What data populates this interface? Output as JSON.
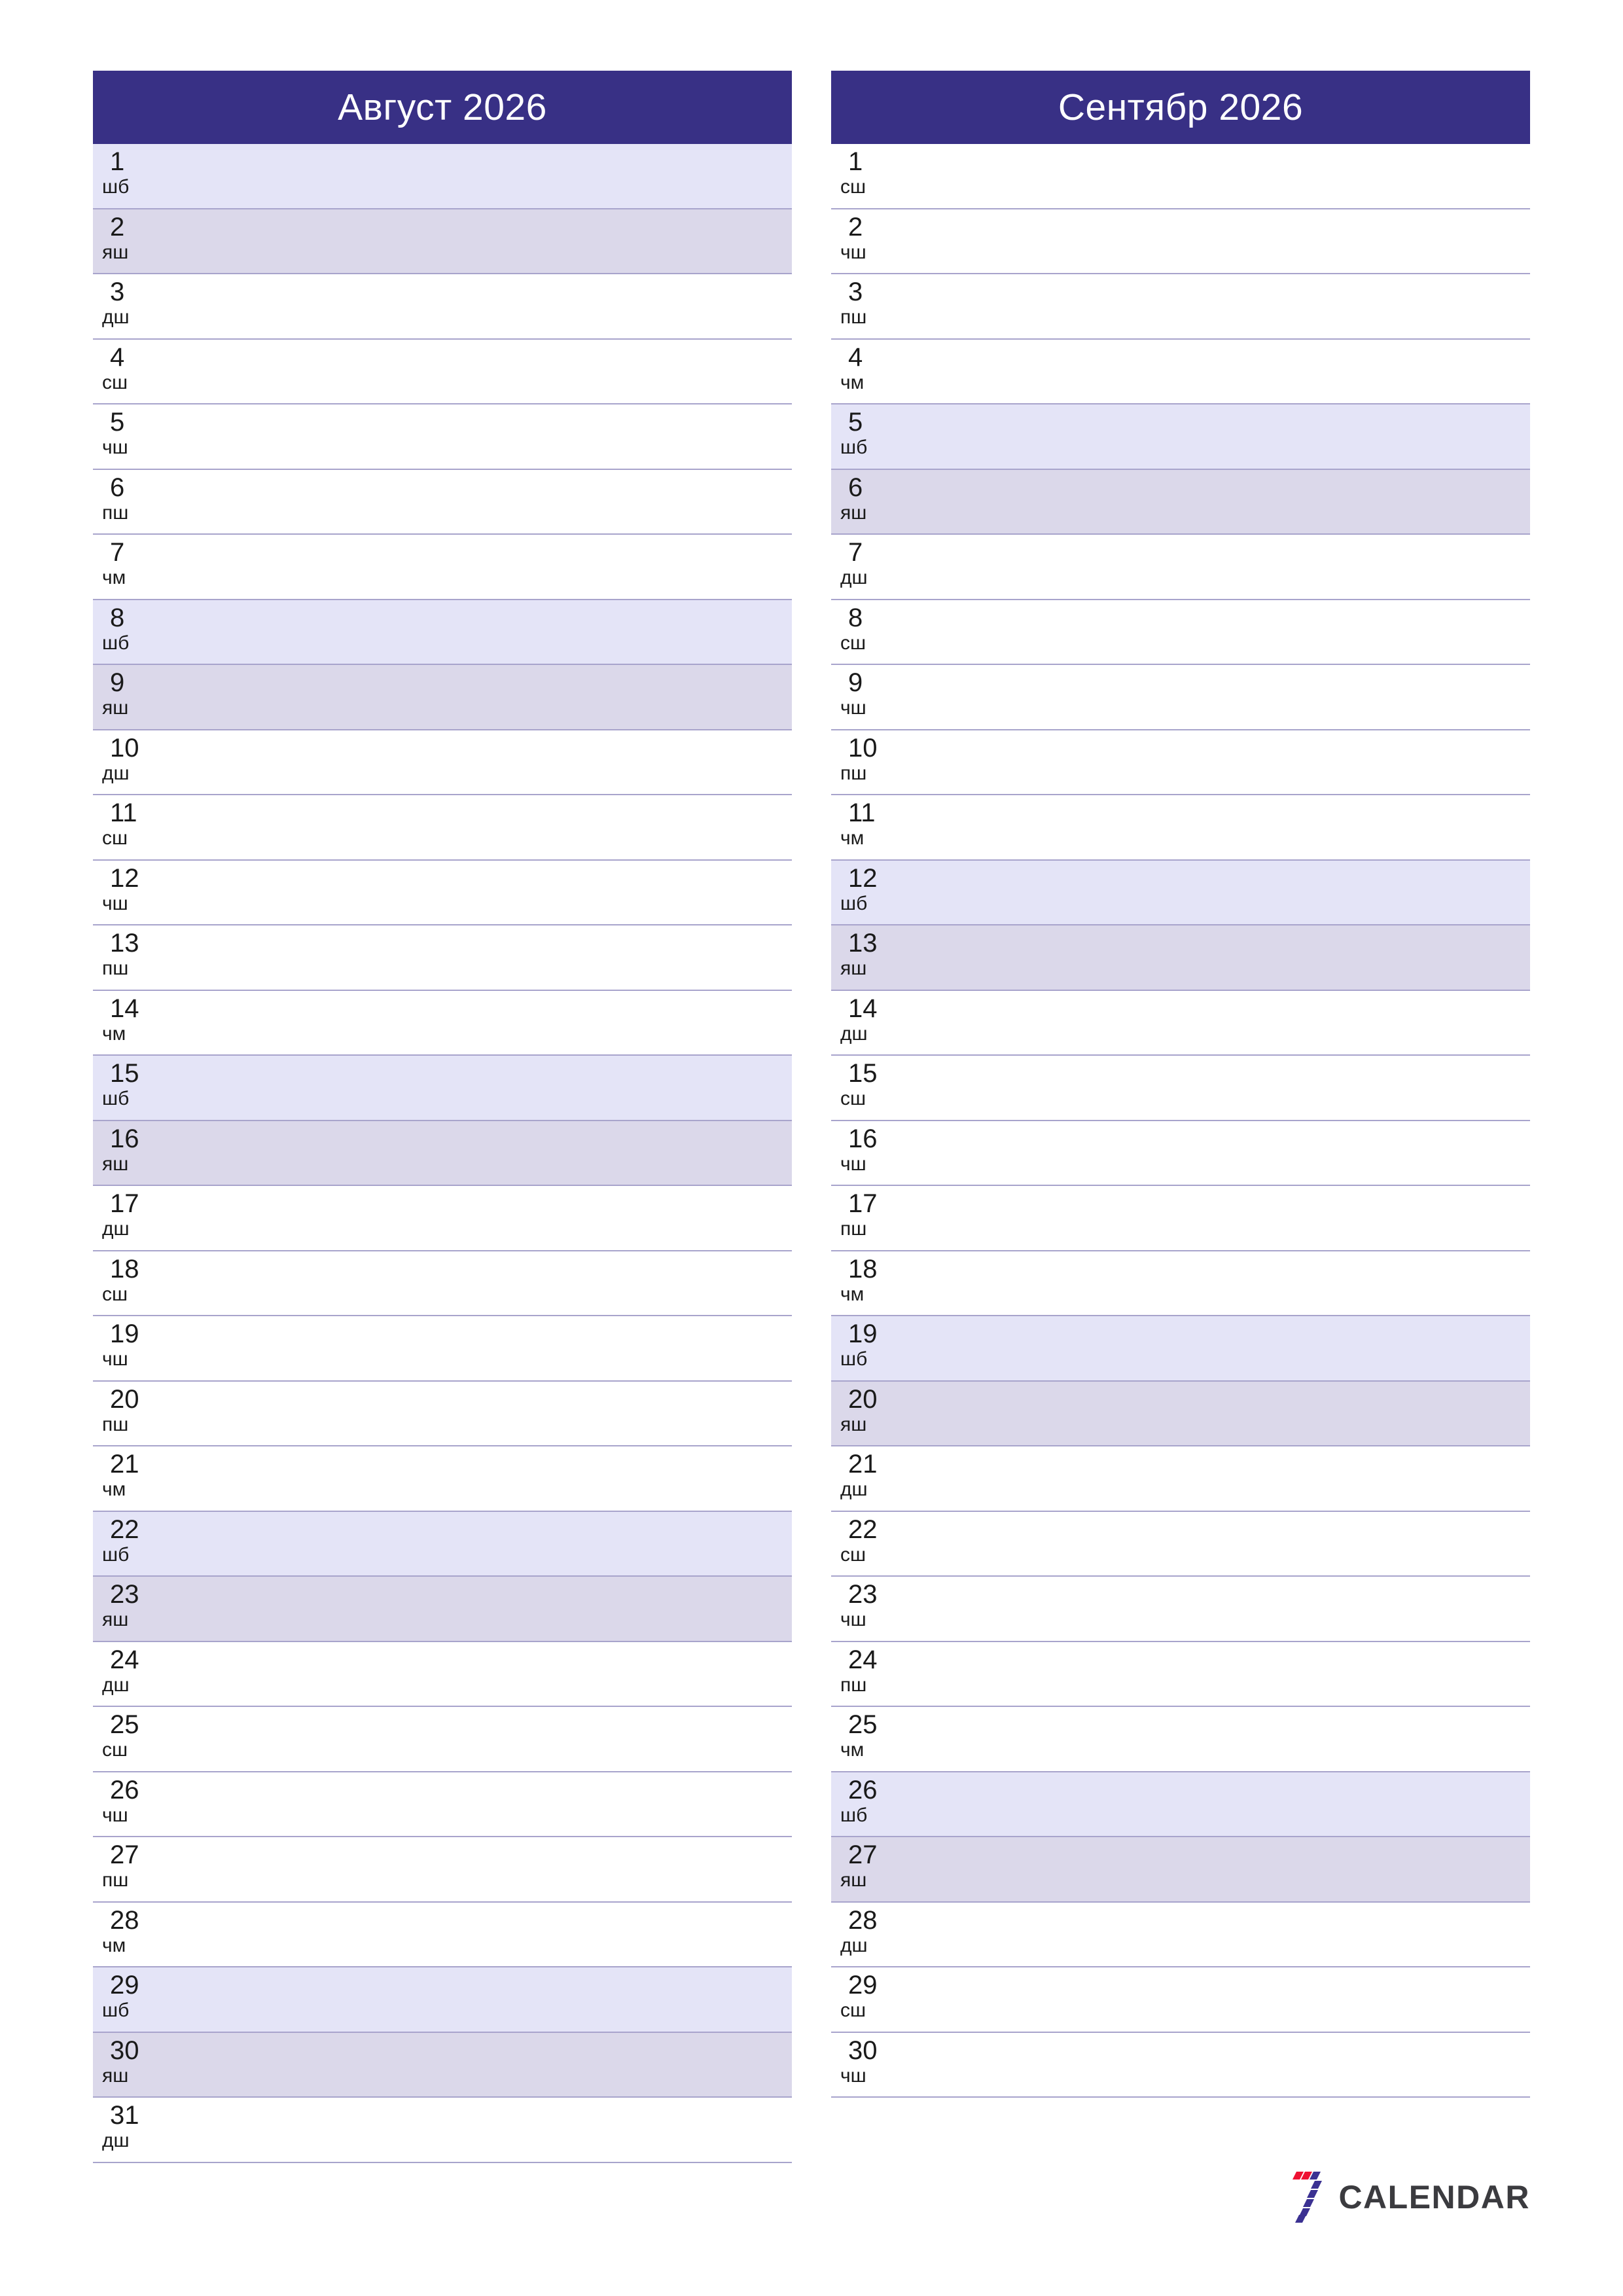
{
  "brand": {
    "logo_icon": "seven-calendar-logo-icon",
    "wordmark": "CALENDAR",
    "accent_red": "#ee1133",
    "accent_blue": "#3b3192",
    "wordmark_color": "#3b3b3f"
  },
  "theme": {
    "header_bg": "#383085",
    "header_text": "#ffffff",
    "saturday_bg": "#e4e4f7",
    "sunday_bg": "#dbd8ea",
    "row_border": "#a8a4cc",
    "page_bg": "#ffffff",
    "day_text": "#1a1a1a"
  },
  "weekday_abbreviations": {
    "monday": "дш",
    "tuesday": "сш",
    "wednesday": "чш",
    "thursday": "пш",
    "friday": "чм",
    "saturday": "шб",
    "sunday": "яш"
  },
  "months": [
    {
      "title": "Август 2026",
      "days": [
        {
          "num": "1",
          "abbr": "шб",
          "kind": "sat"
        },
        {
          "num": "2",
          "abbr": "яш",
          "kind": "sun"
        },
        {
          "num": "3",
          "abbr": "дш",
          "kind": "weekday"
        },
        {
          "num": "4",
          "abbr": "сш",
          "kind": "weekday"
        },
        {
          "num": "5",
          "abbr": "чш",
          "kind": "weekday"
        },
        {
          "num": "6",
          "abbr": "пш",
          "kind": "weekday"
        },
        {
          "num": "7",
          "abbr": "чм",
          "kind": "weekday"
        },
        {
          "num": "8",
          "abbr": "шб",
          "kind": "sat"
        },
        {
          "num": "9",
          "abbr": "яш",
          "kind": "sun"
        },
        {
          "num": "10",
          "abbr": "дш",
          "kind": "weekday"
        },
        {
          "num": "11",
          "abbr": "сш",
          "kind": "weekday"
        },
        {
          "num": "12",
          "abbr": "чш",
          "kind": "weekday"
        },
        {
          "num": "13",
          "abbr": "пш",
          "kind": "weekday"
        },
        {
          "num": "14",
          "abbr": "чм",
          "kind": "weekday"
        },
        {
          "num": "15",
          "abbr": "шб",
          "kind": "sat"
        },
        {
          "num": "16",
          "abbr": "яш",
          "kind": "sun"
        },
        {
          "num": "17",
          "abbr": "дш",
          "kind": "weekday"
        },
        {
          "num": "18",
          "abbr": "сш",
          "kind": "weekday"
        },
        {
          "num": "19",
          "abbr": "чш",
          "kind": "weekday"
        },
        {
          "num": "20",
          "abbr": "пш",
          "kind": "weekday"
        },
        {
          "num": "21",
          "abbr": "чм",
          "kind": "weekday"
        },
        {
          "num": "22",
          "abbr": "шб",
          "kind": "sat"
        },
        {
          "num": "23",
          "abbr": "яш",
          "kind": "sun"
        },
        {
          "num": "24",
          "abbr": "дш",
          "kind": "weekday"
        },
        {
          "num": "25",
          "abbr": "сш",
          "kind": "weekday"
        },
        {
          "num": "26",
          "abbr": "чш",
          "kind": "weekday"
        },
        {
          "num": "27",
          "abbr": "пш",
          "kind": "weekday"
        },
        {
          "num": "28",
          "abbr": "чм",
          "kind": "weekday"
        },
        {
          "num": "29",
          "abbr": "шб",
          "kind": "sat"
        },
        {
          "num": "30",
          "abbr": "яш",
          "kind": "sun"
        },
        {
          "num": "31",
          "abbr": "дш",
          "kind": "weekday"
        }
      ]
    },
    {
      "title": "Сентябр 2026",
      "days": [
        {
          "num": "1",
          "abbr": "сш",
          "kind": "weekday"
        },
        {
          "num": "2",
          "abbr": "чш",
          "kind": "weekday"
        },
        {
          "num": "3",
          "abbr": "пш",
          "kind": "weekday"
        },
        {
          "num": "4",
          "abbr": "чм",
          "kind": "weekday"
        },
        {
          "num": "5",
          "abbr": "шб",
          "kind": "sat"
        },
        {
          "num": "6",
          "abbr": "яш",
          "kind": "sun"
        },
        {
          "num": "7",
          "abbr": "дш",
          "kind": "weekday"
        },
        {
          "num": "8",
          "abbr": "сш",
          "kind": "weekday"
        },
        {
          "num": "9",
          "abbr": "чш",
          "kind": "weekday"
        },
        {
          "num": "10",
          "abbr": "пш",
          "kind": "weekday"
        },
        {
          "num": "11",
          "abbr": "чм",
          "kind": "weekday"
        },
        {
          "num": "12",
          "abbr": "шб",
          "kind": "sat"
        },
        {
          "num": "13",
          "abbr": "яш",
          "kind": "sun"
        },
        {
          "num": "14",
          "abbr": "дш",
          "kind": "weekday"
        },
        {
          "num": "15",
          "abbr": "сш",
          "kind": "weekday"
        },
        {
          "num": "16",
          "abbr": "чш",
          "kind": "weekday"
        },
        {
          "num": "17",
          "abbr": "пш",
          "kind": "weekday"
        },
        {
          "num": "18",
          "abbr": "чм",
          "kind": "weekday"
        },
        {
          "num": "19",
          "abbr": "шб",
          "kind": "sat"
        },
        {
          "num": "20",
          "abbr": "яш",
          "kind": "sun"
        },
        {
          "num": "21",
          "abbr": "дш",
          "kind": "weekday"
        },
        {
          "num": "22",
          "abbr": "сш",
          "kind": "weekday"
        },
        {
          "num": "23",
          "abbr": "чш",
          "kind": "weekday"
        },
        {
          "num": "24",
          "abbr": "пш",
          "kind": "weekday"
        },
        {
          "num": "25",
          "abbr": "чм",
          "kind": "weekday"
        },
        {
          "num": "26",
          "abbr": "шб",
          "kind": "sat"
        },
        {
          "num": "27",
          "abbr": "яш",
          "kind": "sun"
        },
        {
          "num": "28",
          "abbr": "дш",
          "kind": "weekday"
        },
        {
          "num": "29",
          "abbr": "сш",
          "kind": "weekday"
        },
        {
          "num": "30",
          "abbr": "чш",
          "kind": "weekday"
        }
      ]
    }
  ]
}
